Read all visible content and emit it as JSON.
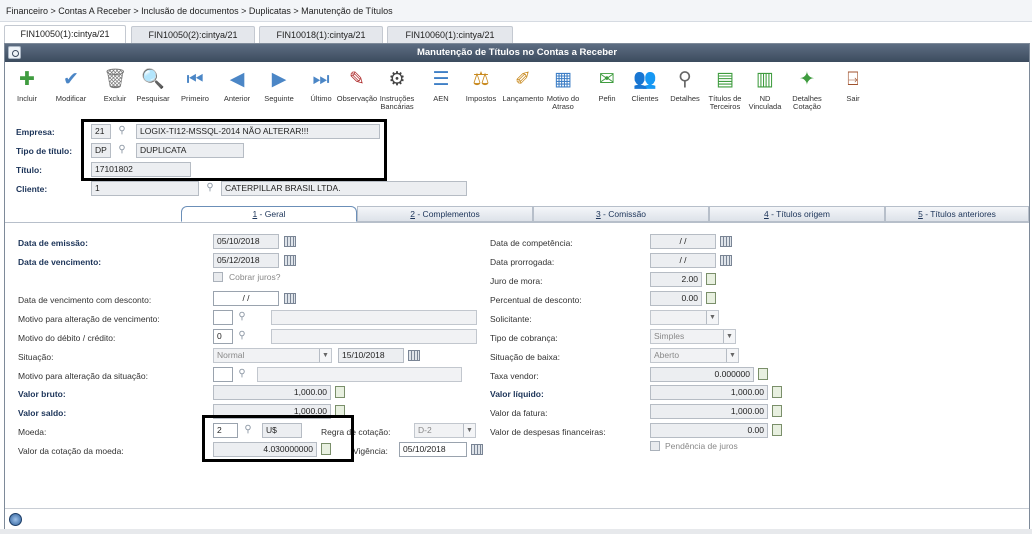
{
  "breadcrumb": "Financeiro > Contas A Receber > Inclusão de documentos > Duplicatas > Manutenção de Títulos",
  "program_tabs": [
    "FIN10050(1):cintya/21",
    "FIN10050(2):cintya/21",
    "FIN10018(1):cintya/21",
    "FIN10060(1):cintya/21"
  ],
  "window_title": "Manutenção de Títulos no Contas a Receber",
  "toolbar": [
    {
      "label": "Incluir",
      "icon": "plus-icon",
      "glyph": "✚",
      "color": "#3f9c3f"
    },
    {
      "label": "Modificar",
      "icon": "edit-check-icon",
      "glyph": "✔",
      "color": "#4b86c6"
    },
    {
      "label": "Excluir",
      "icon": "trash-icon",
      "glyph": "🗑",
      "color": "#777777"
    },
    {
      "label": "Pesquisar",
      "icon": "search-icon",
      "glyph": "🔍",
      "color": "#3f7fc6"
    },
    {
      "label": "Primeiro",
      "icon": "first-icon",
      "glyph": "⏮",
      "color": "#4b86c6"
    },
    {
      "label": "Anterior",
      "icon": "previous-icon",
      "glyph": "◀",
      "color": "#4b86c6"
    },
    {
      "label": "Seguinte",
      "icon": "next-icon",
      "glyph": "▶",
      "color": "#4b86c6"
    },
    {
      "label": "Último",
      "icon": "last-icon",
      "glyph": "⏭",
      "color": "#4b86c6"
    },
    {
      "label": "Observação",
      "icon": "note-pencil-icon",
      "glyph": "✎",
      "color": "#b03030"
    },
    {
      "label": "Instruções Bancárias",
      "icon": "bank-instructions-icon",
      "glyph": "⚙",
      "color": "#444444"
    },
    {
      "label": "AEN",
      "icon": "document-lines-icon",
      "glyph": "☰",
      "color": "#3f7fc6"
    },
    {
      "label": "Impostos",
      "icon": "taxes-icon",
      "glyph": "⚖",
      "color": "#c98a1f"
    },
    {
      "label": "Lançamento",
      "icon": "entry-icon",
      "glyph": "✐",
      "color": "#c98a1f"
    },
    {
      "label": "Motivo do Atraso",
      "icon": "delay-reason-icon",
      "glyph": "▦",
      "color": "#3f7fc6"
    },
    {
      "label": "Pefin",
      "icon": "pefin-icon",
      "glyph": "✉",
      "color": "#3f9c3f"
    },
    {
      "label": "Clientes",
      "icon": "customers-icon",
      "glyph": "👥",
      "color": "#d28b1c"
    },
    {
      "label": "Detalhes",
      "icon": "details-icon",
      "glyph": "⚲",
      "color": "#666666"
    },
    {
      "label": "Títulos de Terceiros",
      "icon": "third-party-titles-icon",
      "glyph": "▤",
      "color": "#3f9c3f"
    },
    {
      "label": "ND Vinculada",
      "icon": "linked-nd-icon",
      "glyph": "▥",
      "color": "#3f9c3f"
    },
    {
      "label": "Detalhes Cotação",
      "icon": "quote-details-icon",
      "glyph": "✦",
      "color": "#3f9c3f"
    },
    {
      "label": "Sair",
      "icon": "exit-door-icon",
      "glyph": "⍈",
      "color": "#a0522d"
    }
  ],
  "header": {
    "empresa": {
      "label": "Empresa:",
      "code": "21",
      "name": "LOGIX-TI12-MSSQL-2014 NÃO ALTERAR!!!"
    },
    "tipo_titulo": {
      "label": "Tipo de título:",
      "code": "DP",
      "name": "DUPLICATA"
    },
    "titulo": {
      "label": "Título:",
      "value": "17101802"
    },
    "cliente": {
      "label": "Cliente:",
      "code": "1",
      "name": "CATERPILLAR BRASIL LTDA."
    }
  },
  "subtabs": [
    {
      "key": "1",
      "label": " - Geral"
    },
    {
      "key": "2",
      "label": " - Complementos"
    },
    {
      "key": "3",
      "label": " - Comissão"
    },
    {
      "key": "4",
      "label": " - Títulos origem"
    },
    {
      "key": "5",
      "label": " - Títulos anteriores"
    }
  ],
  "left": {
    "data_emissao": {
      "label": "Data de emissão:",
      "value": "05/10/2018"
    },
    "data_vencimento": {
      "label": "Data de vencimento:",
      "value": "05/12/2018"
    },
    "cobrar_juros": {
      "label": "Cobrar juros?"
    },
    "data_venc_desconto": {
      "label": "Data de vencimento com desconto:",
      "value": " / /"
    },
    "motivo_alt_venc": {
      "label": "Motivo para alteração de vencimento:",
      "value": ""
    },
    "motivo_debito": {
      "label": "Motivo do débito / crédito:",
      "value": "0"
    },
    "situacao": {
      "label": "Situação:",
      "value": "Normal",
      "date": "15/10/2018"
    },
    "motivo_alt_situacao": {
      "label": "Motivo para alteração da situação:",
      "value": ""
    },
    "valor_bruto": {
      "label": "Valor bruto:",
      "value": "1,000.00"
    },
    "valor_saldo": {
      "label": "Valor saldo:",
      "value": "1,000.00"
    },
    "moeda": {
      "label": "Moeda:",
      "code": "2",
      "name": "U$"
    },
    "regra_cotacao": {
      "label": "Regra de cotação:",
      "value": "D-2"
    },
    "valor_cotacao": {
      "label": "Valor da cotação da moeda:",
      "value": "4.030000000"
    },
    "vigencia": {
      "label": "Vigência:",
      "value": "05/10/2018"
    }
  },
  "right": {
    "data_competencia": {
      "label": "Data de competência:",
      "value": " / /"
    },
    "data_prorrogada": {
      "label": "Data prorrogada:",
      "value": " / /"
    },
    "juro_mora": {
      "label": "Juro de mora:",
      "value": "2.00"
    },
    "perc_desconto": {
      "label": "Percentual de desconto:",
      "value": "0.00"
    },
    "solicitante": {
      "label": "Solicitante:",
      "value": ""
    },
    "tipo_cobranca": {
      "label": "Tipo de cobrança:",
      "value": "Simples"
    },
    "situacao_baixa": {
      "label": "Situação de baixa:",
      "value": "Aberto"
    },
    "taxa_vendor": {
      "label": "Taxa vendor:",
      "value": "0.000000"
    },
    "valor_liquido": {
      "label": "Valor líquido:",
      "value": "1,000.00"
    },
    "valor_fatura": {
      "label": "Valor da fatura:",
      "value": "1,000.00"
    },
    "despesas_financeiras": {
      "label": "Valor de despesas financeiras:",
      "value": "0.00"
    },
    "pendencia_juros": {
      "label": "Pendência de juros"
    }
  },
  "colors": {
    "accent": "#1b3358",
    "titlebar": "#4a5a6e",
    "highlight": "#000000"
  }
}
